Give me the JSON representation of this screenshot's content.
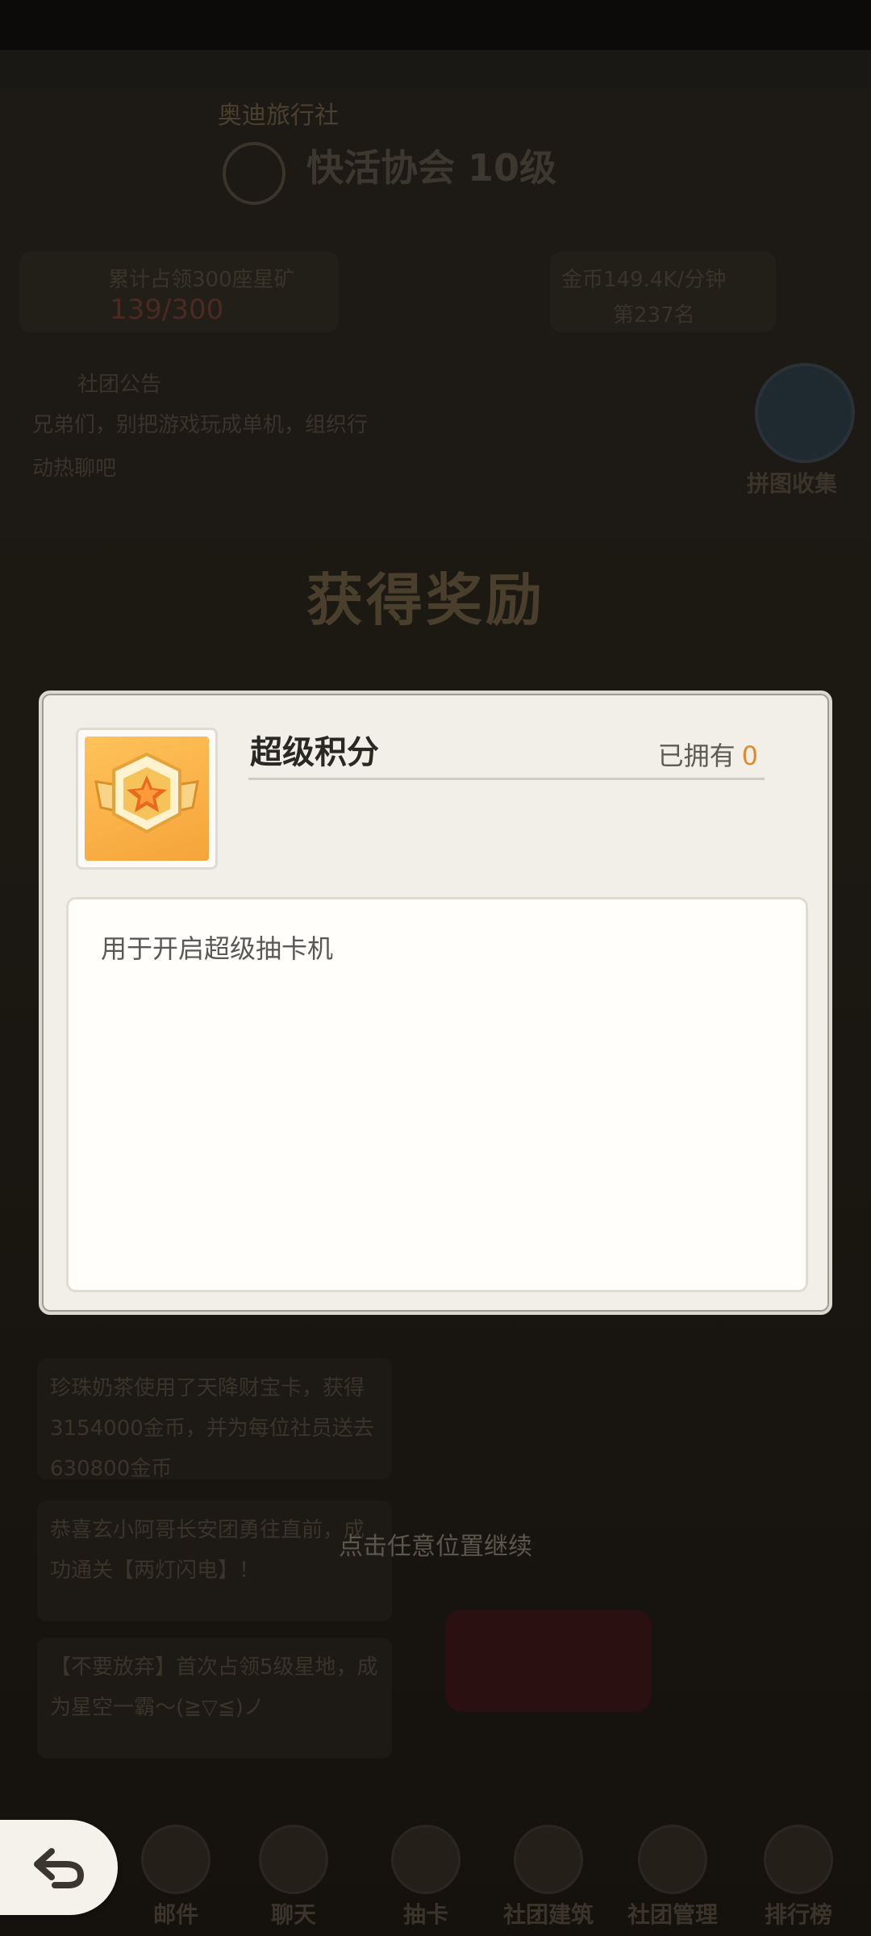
{
  "background": {
    "top_label": "奥迪旅行社",
    "guild_title": "快活协会 10级",
    "resource_left": {
      "label": "累计占领300座星矿",
      "value": "139/300"
    },
    "resource_right": {
      "label": "金币149.4K/分钟",
      "rank": "第237名"
    },
    "announcement": {
      "title": "社团公告",
      "text": "兄弟们，别把游戏玩成单机，组织行动热聊吧"
    },
    "collection_label": "拼图收集",
    "reward_heading": "获得奖励",
    "messages": [
      "珍珠奶茶使用了天降财宝卡，获得3154000金币，并为每位社员送去630800金币",
      "恭喜玄小阿哥长安团勇往直前，成功通关【两灯闪电】！",
      "【不要放弃】首次占领5级星地，成为星空一霸～(≧▽≦)ノ"
    ]
  },
  "continue_hint": "点击任意位置继续",
  "nav": [
    {
      "label": "邮件",
      "icon": "mail-icon"
    },
    {
      "label": "聊天",
      "icon": "chat-icon"
    },
    {
      "label": "抽卡",
      "icon": "gacha-icon"
    },
    {
      "label": "社团建筑",
      "icon": "building-icon"
    },
    {
      "label": "社团管理",
      "icon": "members-icon"
    },
    {
      "label": "排行榜",
      "icon": "ranking-icon"
    }
  ],
  "dialog": {
    "item_name": "超级积分",
    "owned_label": "已拥有",
    "owned_count": "0",
    "description": "用于开启超级抽卡机",
    "item_icon": "star-badge-icon"
  },
  "colors": {
    "dialog_bg": "#f1efe8",
    "owned_count": "#e08a30",
    "icon_bg": "#f5a43a"
  }
}
